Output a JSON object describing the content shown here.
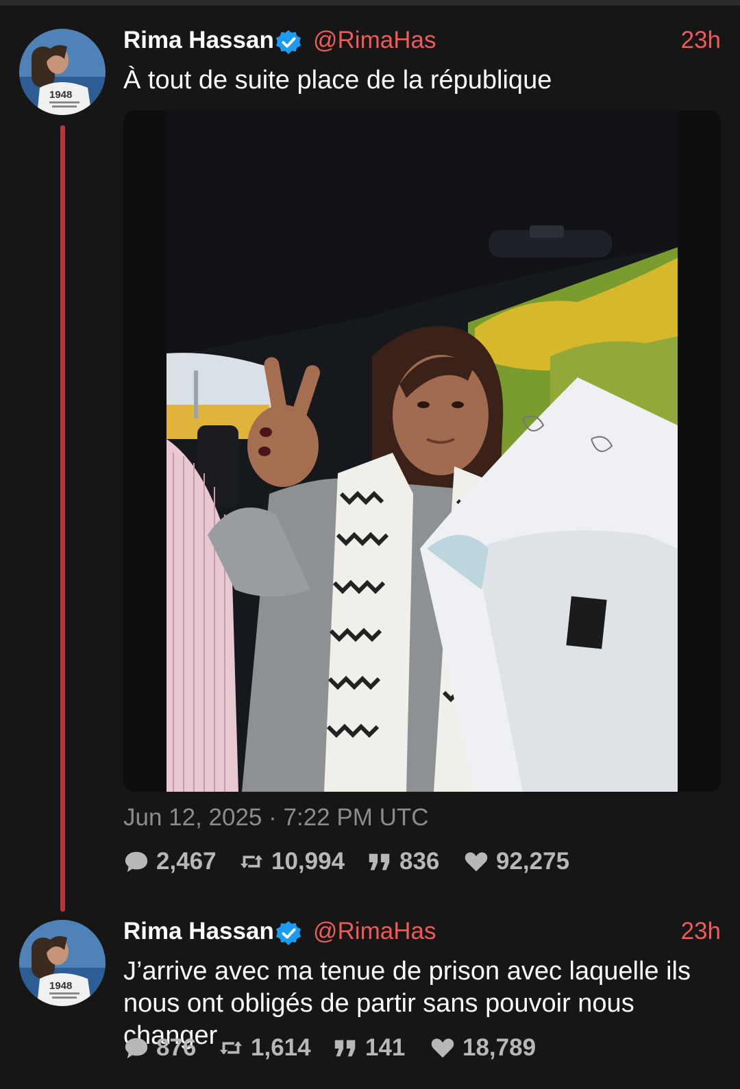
{
  "tweets": [
    {
      "author": {
        "name": "Rima Hassan",
        "handle": "@RimaHas",
        "avatar_shirt_text": "1948",
        "verified": true
      },
      "time": "23h",
      "text": "À tout de suite place de la république",
      "date": "Jun 12, 2025 · 7:22 PM UTC",
      "stats": {
        "replies": "2,467",
        "retweets": "10,994",
        "quotes": "836",
        "likes": "92,275"
      }
    },
    {
      "author": {
        "name": "Rima Hassan",
        "handle": "@RimaHas",
        "avatar_shirt_text": "1948",
        "verified": true
      },
      "time": "23h",
      "text_lines": [
        "J’arrive avec ma tenue de prison avec laquelle ils",
        "nous ont obligés de partir sans pouvoir nous changer"
      ],
      "stats": {
        "replies": "876",
        "retweets": "1,614",
        "quotes": "141",
        "likes": "18,789"
      }
    }
  ],
  "icons": {
    "verified": "verified-badge-icon",
    "reply": "comment-icon",
    "retweet": "retweet-icon",
    "quote": "quote-icon",
    "like": "heart-icon"
  },
  "colors": {
    "background": "#161616",
    "accent": "#ef5b57",
    "thread_line": "#b8353a",
    "verified": "#1d9bf0",
    "muted": "#8c8c8c",
    "stat_text": "#b8b8b8"
  }
}
